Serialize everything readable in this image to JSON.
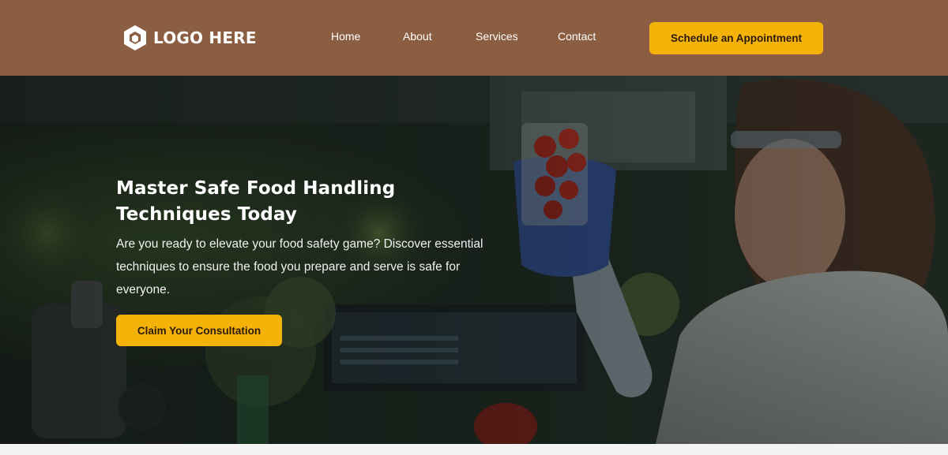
{
  "header": {
    "logo_text": "LOGO HERE",
    "logo_icon": "hexagon-logo-icon",
    "nav": [
      {
        "label": "Home"
      },
      {
        "label": "About"
      },
      {
        "label": "Services"
      },
      {
        "label": "Contact"
      }
    ],
    "cta_label": "Schedule an Appointment"
  },
  "hero": {
    "title": "Master Safe Food Handling Techniques Today",
    "description": "Are you ready to elevate your food safety game? Discover essential techniques to ensure the food you prepare and serve is safe for everyone.",
    "button_label": "Claim Your Consultation",
    "image": "scientist-inspecting-strawberries-in-lab"
  },
  "colors": {
    "header_bg": "#8b5e42",
    "accent": "#f5b30a",
    "hero_text": "#ffffff"
  }
}
